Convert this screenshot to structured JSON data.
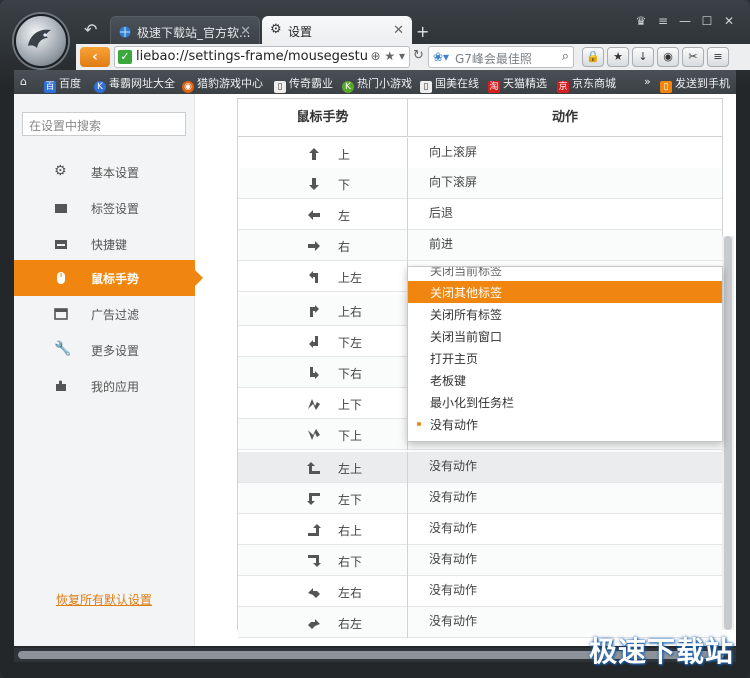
{
  "tabs": [
    {
      "label": "极速下载站_官方软..."
    },
    {
      "label": "设置"
    }
  ],
  "toolbar": {
    "url": "liebao://settings-frame/mousegestu",
    "search_placeholder": "G7峰会最佳照"
  },
  "bookmarks": [
    {
      "label": "百度",
      "color": "#2f6fd6"
    },
    {
      "label": "毒霸网址大全",
      "color": "#2f6fd6"
    },
    {
      "label": "猎豹游戏中心",
      "color": "#e06010"
    },
    {
      "label": "传奇霸业",
      "color": "#eeeeee"
    },
    {
      "label": "热门小游戏",
      "color": "#5aa82a"
    },
    {
      "label": "国美在线",
      "color": "#eeeeee"
    },
    {
      "label": "天猫精选",
      "color": "#d42020"
    },
    {
      "label": "京东商城",
      "color": "#d42020"
    },
    {
      "label": "发送到手机",
      "color": "#f0860f"
    }
  ],
  "sidebar": {
    "search_placeholder": "在设置中搜索",
    "items": [
      {
        "label": "基本设置",
        "icon": "gear-icon"
      },
      {
        "label": "标签设置",
        "icon": "tab-icon"
      },
      {
        "label": "快捷键",
        "icon": "keyboard-icon"
      },
      {
        "label": "鼠标手势",
        "icon": "mouse-icon",
        "active": true
      },
      {
        "label": "广告过滤",
        "icon": "filter-icon"
      },
      {
        "label": "更多设置",
        "icon": "wrench-icon"
      },
      {
        "label": "我的应用",
        "icon": "puzzle-icon"
      }
    ],
    "restore": "恢复所有默认设置"
  },
  "table": {
    "header_gesture": "鼠标手势",
    "header_action": "动作",
    "rows": [
      {
        "gesture": "上",
        "action": "向上滚屏"
      },
      {
        "gesture": "下",
        "action": "向下滚屏"
      },
      {
        "gesture": "左",
        "action": "后退"
      },
      {
        "gesture": "右",
        "action": "前进"
      },
      {
        "gesture": "上左",
        "action": ""
      },
      {
        "gesture": "上右",
        "action": ""
      },
      {
        "gesture": "下左",
        "action": ""
      },
      {
        "gesture": "下右",
        "action": ""
      },
      {
        "gesture": "上下",
        "action": ""
      },
      {
        "gesture": "下上",
        "action": ""
      },
      {
        "gesture": "左上",
        "action": "没有动作"
      },
      {
        "gesture": "左下",
        "action": "没有动作"
      },
      {
        "gesture": "右上",
        "action": "没有动作"
      },
      {
        "gesture": "右下",
        "action": "没有动作"
      },
      {
        "gesture": "左右",
        "action": "没有动作"
      },
      {
        "gesture": "右左",
        "action": "没有动作"
      }
    ]
  },
  "dropdown": {
    "options": [
      {
        "label": "关闭当前标签"
      },
      {
        "label": "关闭其他标签",
        "highlighted": true
      },
      {
        "label": "关闭所有标签"
      },
      {
        "label": "关闭当前窗口"
      },
      {
        "label": "打开主页"
      },
      {
        "label": "老板键"
      },
      {
        "label": "最小化到任务栏"
      },
      {
        "label": "没有动作",
        "selected": true
      }
    ]
  },
  "watermark": "极速下载站",
  "colors": {
    "accent": "#f0860f",
    "frame": "#2a2f33"
  }
}
